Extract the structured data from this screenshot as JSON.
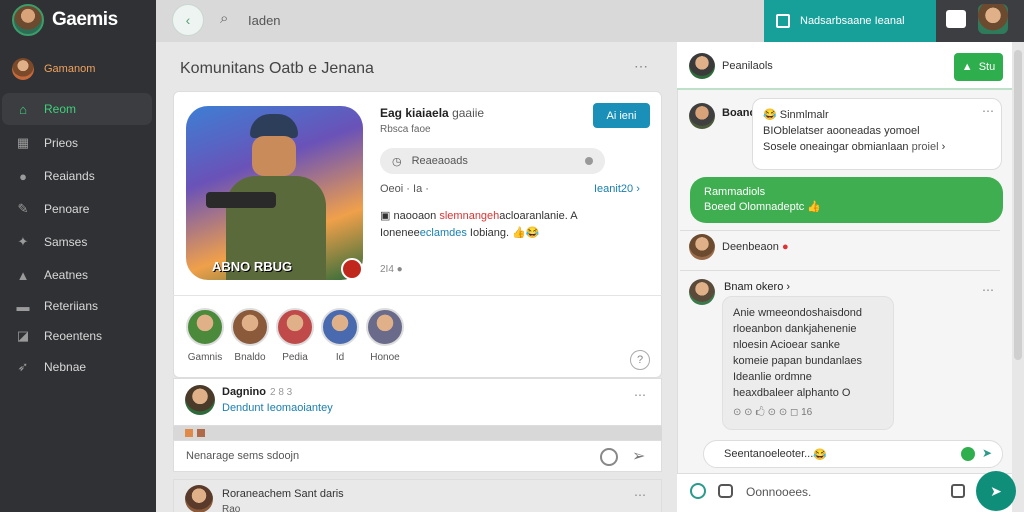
{
  "app": {
    "name": "Gaemis"
  },
  "sidebar": {
    "user": "Gamanom",
    "items": [
      {
        "label": "Reom",
        "icon": "home-icon",
        "active": true
      },
      {
        "label": "Prieos",
        "icon": "grid-icon"
      },
      {
        "label": "Reaiands",
        "icon": "trophy-icon"
      },
      {
        "label": "Penoare",
        "icon": "wrench-icon"
      },
      {
        "label": "Samses",
        "icon": "controller-icon"
      },
      {
        "label": "Aeatnes",
        "icon": "people-icon"
      },
      {
        "label": "Reteriians",
        "icon": "list-icon"
      },
      {
        "label": "Reoentens",
        "icon": "bookmark-icon"
      },
      {
        "label": "Nebnae",
        "icon": "rocket-icon"
      }
    ]
  },
  "topbar": {
    "search_value": "Iaden",
    "action_label": "Nadsarbsaane Ieanal"
  },
  "main": {
    "title": "Komunitans Oatb e Jenana",
    "game": {
      "title": "Eag kiaiaela",
      "title_extra": "gaaiie",
      "subtitle": "Rbsca faoe",
      "cover_caption": "ABNO RBUG",
      "join_label": "Ai ieni",
      "pill_label": "Reaeaoads",
      "stats": "Oeoi  ·  Ia  ·",
      "stats_link": "Ieanit20",
      "desc_line1_a": "naooaon",
      "desc_line1_b": "slemnangeh",
      "desc_line1_c": "acloaranlanie. A",
      "desc_line2_a": "Ionenee",
      "desc_line2_b": "eclamdes",
      "desc_line2_c": "Iobiang.",
      "meta": "2I4"
    },
    "members": [
      {
        "label": "Gamnis",
        "color": "#4a8a3a"
      },
      {
        "label": "Bnaldo",
        "color": "#8a5a3a"
      },
      {
        "label": "Pedia",
        "color": "#c04a4a"
      },
      {
        "label": "Id",
        "color": "#4a6ab0"
      },
      {
        "label": "Honoe",
        "color": "#6a6a8a"
      }
    ],
    "post": {
      "author": "Dagnino",
      "time": "2 8 3",
      "text": "Dendunt Ieomaoiantey"
    },
    "comment_placeholder": "Nenarage sems sdoojn",
    "post2": {
      "author": "Roraneachem Sant daris",
      "text": "Rao"
    }
  },
  "chat": {
    "header": {
      "name": "Peanilaols",
      "button": "Stu"
    },
    "messages": [
      {
        "author": "Boano",
        "line1": "Sinmlmalr",
        "line2": "BIOblelatser aooneadas yomoel",
        "line3": "Sosele oneaingar obmianlaan",
        "line3_link": "proiel"
      },
      {
        "green_line1": "Rammadiols",
        "green_line2": "Boeed Olomnadeptc"
      },
      {
        "author": "Deenbeaon"
      },
      {
        "author": "Bnam okero",
        "lines": [
          "Anie wmeeondoshaisdond",
          "rloeanbon dankjahenenie",
          "nloesin Acioear sanke",
          "komeie papan bundanlaes",
          "Ideanlie ordmne",
          "heaxdbaleer alphanto O"
        ],
        "counts": "16"
      }
    ],
    "reply": "Seentanoeleoter...",
    "compose_placeholder": "Oonnooees."
  }
}
